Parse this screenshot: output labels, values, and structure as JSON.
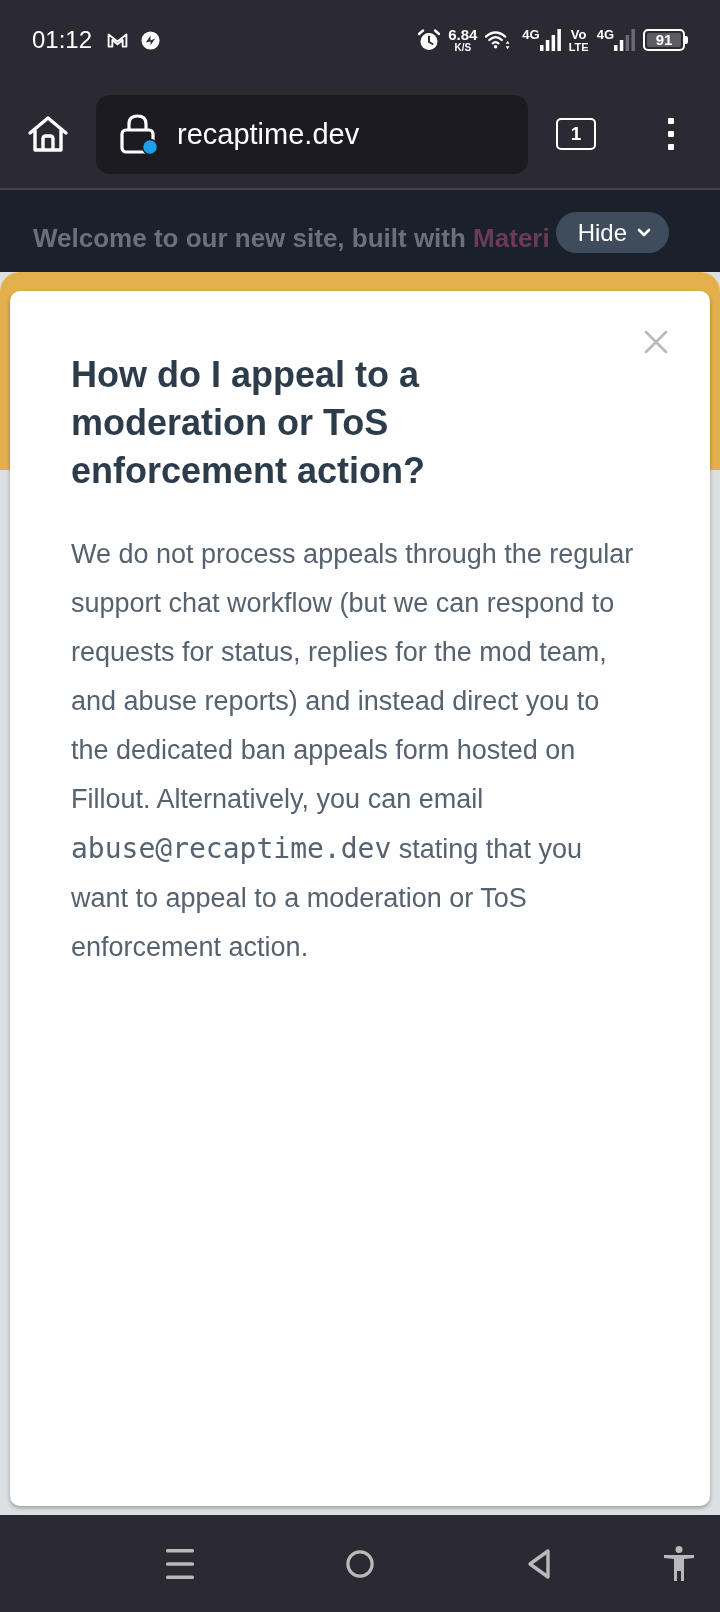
{
  "status_bar": {
    "time": "01:12",
    "network_speed": "6.84",
    "network_speed_unit": "K/S",
    "sim_1_network": "4G",
    "volte_top": "Vo",
    "volte_bottom": "LTE",
    "sim_2_network": "4G",
    "battery_percent": "91"
  },
  "toolbar": {
    "url": "recaptime.dev",
    "tab_count": "1"
  },
  "banner": {
    "text": "Welcome to our new site, built with",
    "link": "Materi",
    "hide_button": "Hide"
  },
  "dialog": {
    "title": "How do I appeal to a moderation or ToS enforcement action?",
    "body": [
      {
        "kind": "text",
        "text": "We do not process appeals through the regular support chat workflow (but we can respond to requests for status, replies for the mod team, and abuse reports) and instead direct you to the dedicated ban appeals form hosted on Fillout. Alternatively, you can email "
      },
      {
        "kind": "code",
        "text": "abuse@recaptime.dev"
      },
      {
        "kind": "text",
        "text": " stating that you want to appeal to a moderation or ToS enforcement action."
      }
    ]
  }
}
